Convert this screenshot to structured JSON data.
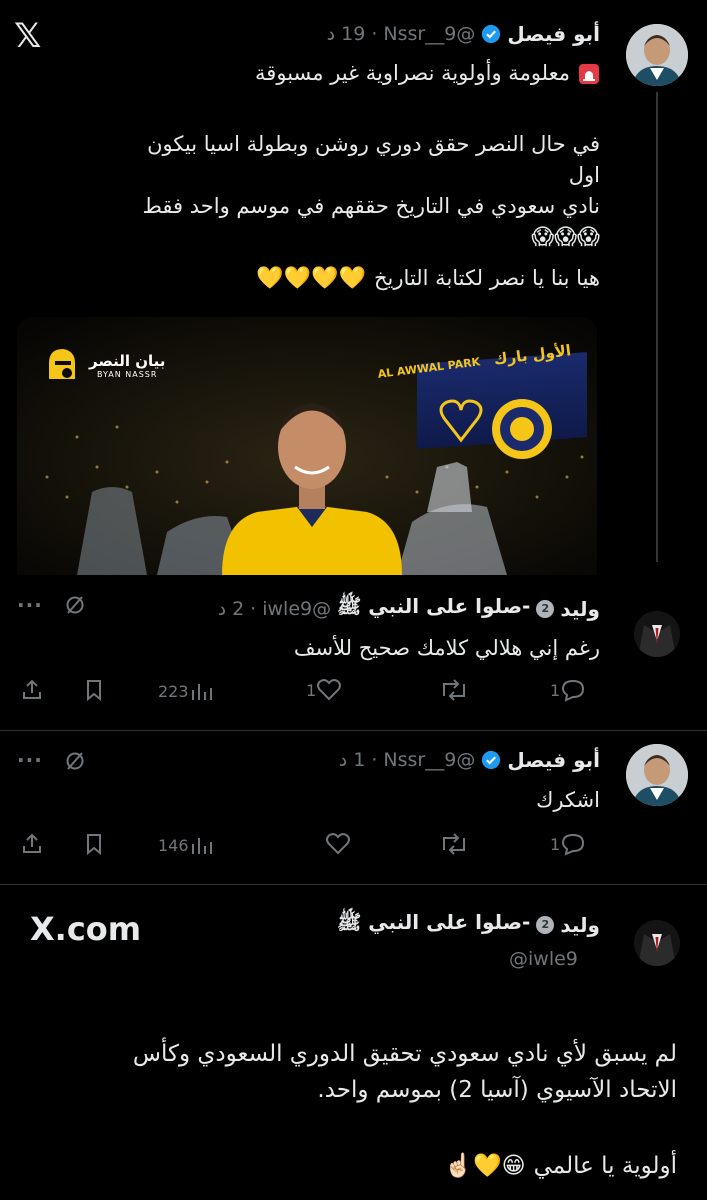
{
  "header": {
    "x_logo": "𝕏"
  },
  "tweet1": {
    "name": "أبو فيصل",
    "handle": "@Nssr__9",
    "time": "19 د",
    "sep": "·",
    "line1": "معلومة وأولوية نصراوية غير مسبوقة",
    "para1a": "في حال النصر حقق دوري روشن وبطولة اسيا بيكون اول",
    "para1b": "نادي سعودي في التاريخ حققهم في موسم واحد فقط",
    "emoji_row": "😱😱😱",
    "para2": "هيا بنا يا نصر لكتابة التاريخ",
    "hearts": "💛💛💛💛",
    "image": {
      "brand_ar": "بيان النصر",
      "brand_en": "BYAN NASSR",
      "stadium_ar": "الأول بارك",
      "stadium_en": "AL AWWAL PARK"
    }
  },
  "reply1": {
    "name": "وليد",
    "badge": "2",
    "name_suffix": "-صلوا على النبي ﷺ",
    "handle": "@iwle9",
    "time": "2 د",
    "sep": "·",
    "text": "رغم إني هلالي كلامك صحيح للأسف",
    "views": "223",
    "likes": "1",
    "replies": "1",
    "more": "···"
  },
  "reply2": {
    "name": "أبو فيصل",
    "handle": "@Nssr__9",
    "time": "1 د",
    "sep": "·",
    "text": "اشكرك",
    "views": "146",
    "replies": "1",
    "more": "···"
  },
  "quoted": {
    "site": "X.com",
    "name": "وليد",
    "badge": "2",
    "name_suffix": "-صلوا على النبي ﷺ",
    "handle": "@iwle9",
    "line1": "لم يسبق لأي نادي سعودي تحقيق الدوري السعودي وكأس",
    "line2": "الاتحاد الآسيوي (آسيا 2) بموسم واحد.",
    "line3": "أولوية يا عالمي",
    "line3_emoji": "😁💛☝🏻"
  },
  "colors": {
    "accent": "#1d9bf0",
    "gold": "#f5c518",
    "muted": "#71767b",
    "text": "#e7e9ea"
  }
}
